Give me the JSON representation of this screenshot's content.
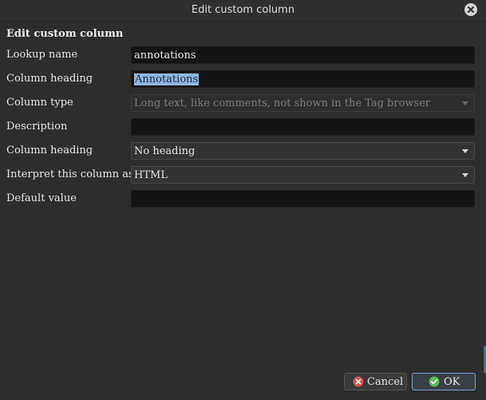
{
  "window": {
    "title": "Edit custom column"
  },
  "group": {
    "title": "Edit custom column"
  },
  "fields": {
    "lookup_name": {
      "label": "Lookup name",
      "value": "annotations"
    },
    "column_heading": {
      "label": "Column heading",
      "value": "Annotations"
    },
    "column_type": {
      "label": "Column type",
      "value": "Long text, like comments, not shown in the Tag browser"
    },
    "description": {
      "label": "Description",
      "value": ""
    },
    "heading_position": {
      "label": "Column heading",
      "value": "No heading"
    },
    "interpret_as": {
      "label": "Interpret this column as:",
      "value": "HTML"
    },
    "default_value": {
      "label": "Default value",
      "value": ""
    }
  },
  "buttons": {
    "cancel": "Cancel",
    "ok": "OK"
  },
  "icons": {
    "close": "close-icon",
    "cancel": "cancel-icon",
    "ok": "ok-check-icon"
  },
  "colors": {
    "background": "#2d2d2d",
    "input_bg": "#141414",
    "selection": "#8fb7e3",
    "ok_border": "#7ba4cf",
    "cancel_icon": "#d9534f",
    "ok_icon": "#5cb85c"
  }
}
